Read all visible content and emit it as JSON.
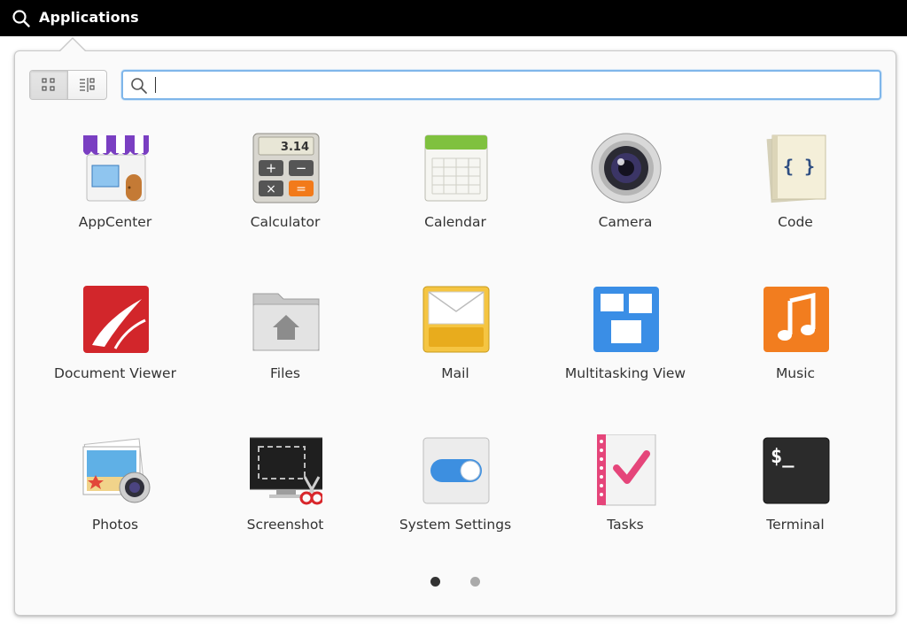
{
  "panel": {
    "title": "Applications"
  },
  "search": {
    "placeholder": "",
    "value": ""
  },
  "view_switcher": {
    "active": "grid"
  },
  "apps": [
    {
      "label": "AppCenter",
      "icon": "appcenter-icon"
    },
    {
      "label": "Calculator",
      "icon": "calculator-icon",
      "display": "3.14"
    },
    {
      "label": "Calendar",
      "icon": "calendar-icon"
    },
    {
      "label": "Camera",
      "icon": "camera-icon"
    },
    {
      "label": "Code",
      "icon": "code-icon",
      "glyph": "{ }"
    },
    {
      "label": "Document Viewer",
      "icon": "document-viewer-icon"
    },
    {
      "label": "Files",
      "icon": "files-icon"
    },
    {
      "label": "Mail",
      "icon": "mail-icon"
    },
    {
      "label": "Multitasking View",
      "icon": "multitasking-view-icon"
    },
    {
      "label": "Music",
      "icon": "music-icon"
    },
    {
      "label": "Photos",
      "icon": "photos-icon"
    },
    {
      "label": "Screenshot",
      "icon": "screenshot-icon"
    },
    {
      "label": "System Settings",
      "icon": "system-settings-icon"
    },
    {
      "label": "Tasks",
      "icon": "tasks-icon"
    },
    {
      "label": "Terminal",
      "icon": "terminal-icon",
      "prompt": "$_"
    }
  ],
  "pagination": {
    "pages": 2,
    "current": 1
  },
  "colors": {
    "topbar": "#000000",
    "search_focus": "#7fb6ea",
    "dot_active": "#333333",
    "dot_inactive": "#aaaaaa"
  }
}
